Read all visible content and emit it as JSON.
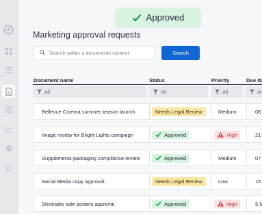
{
  "toast": {
    "text": "Approved"
  },
  "page": {
    "title": "Marketing approval requests"
  },
  "search": {
    "placeholder": "Search within a documents content",
    "button_label": "Search"
  },
  "table": {
    "columns": [
      {
        "label": "Document name"
      },
      {
        "label": "Status"
      },
      {
        "label": "Priority"
      },
      {
        "label": "Due da"
      }
    ],
    "filter_label": "All",
    "rows": [
      {
        "name": "Bellevue Cinema summer season launch",
        "status": "Needs Legal Review",
        "status_type": "legal",
        "priority": "Medium",
        "priority_type": "normal",
        "due": "08"
      },
      {
        "name": "Image review for Bright Lights campaign",
        "status": "Approved",
        "status_type": "approved",
        "priority": "High",
        "priority_type": "high",
        "due": "21"
      },
      {
        "name": "Supplements packaging compliance review",
        "status": "Approved",
        "status_type": "approved",
        "priority": "Medium",
        "priority_type": "normal",
        "due": "07"
      },
      {
        "name": "Social Media copy approval",
        "status": "Needs Legal Review",
        "status_type": "legal",
        "priority": "Low",
        "priority_type": "normal",
        "due": "16"
      },
      {
        "name": "Stocktake sale posters approval",
        "status": "Approved",
        "status_type": "approved",
        "priority": "High",
        "priority_type": "high",
        "due": "5 M"
      }
    ]
  },
  "sidebar": {
    "icons": [
      "logo-icon",
      "dashboard-icon",
      "list-icon",
      "document-icon",
      "grid-icon",
      "chart-icon",
      "gear-icon",
      "lightbulb-icon"
    ],
    "active": "document-icon"
  },
  "colors": {
    "accent": "#0f66d4",
    "approved_bg": "#d8f3e2",
    "legal_bg": "#fbe7a3",
    "high_bg": "#fbe1e1",
    "high_text": "#c43a3a"
  }
}
